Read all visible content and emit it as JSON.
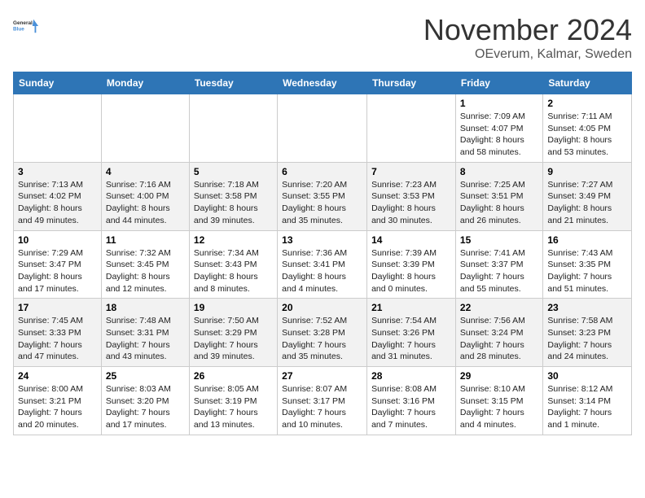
{
  "logo": {
    "line1": "General",
    "line2": "Blue"
  },
  "header": {
    "month": "November 2024",
    "location": "OEverum, Kalmar, Sweden"
  },
  "weekdays": [
    "Sunday",
    "Monday",
    "Tuesday",
    "Wednesday",
    "Thursday",
    "Friday",
    "Saturday"
  ],
  "weeks": [
    [
      {
        "day": "",
        "info": ""
      },
      {
        "day": "",
        "info": ""
      },
      {
        "day": "",
        "info": ""
      },
      {
        "day": "",
        "info": ""
      },
      {
        "day": "",
        "info": ""
      },
      {
        "day": "1",
        "info": "Sunrise: 7:09 AM\nSunset: 4:07 PM\nDaylight: 8 hours and 58 minutes."
      },
      {
        "day": "2",
        "info": "Sunrise: 7:11 AM\nSunset: 4:05 PM\nDaylight: 8 hours and 53 minutes."
      }
    ],
    [
      {
        "day": "3",
        "info": "Sunrise: 7:13 AM\nSunset: 4:02 PM\nDaylight: 8 hours and 49 minutes."
      },
      {
        "day": "4",
        "info": "Sunrise: 7:16 AM\nSunset: 4:00 PM\nDaylight: 8 hours and 44 minutes."
      },
      {
        "day": "5",
        "info": "Sunrise: 7:18 AM\nSunset: 3:58 PM\nDaylight: 8 hours and 39 minutes."
      },
      {
        "day": "6",
        "info": "Sunrise: 7:20 AM\nSunset: 3:55 PM\nDaylight: 8 hours and 35 minutes."
      },
      {
        "day": "7",
        "info": "Sunrise: 7:23 AM\nSunset: 3:53 PM\nDaylight: 8 hours and 30 minutes."
      },
      {
        "day": "8",
        "info": "Sunrise: 7:25 AM\nSunset: 3:51 PM\nDaylight: 8 hours and 26 minutes."
      },
      {
        "day": "9",
        "info": "Sunrise: 7:27 AM\nSunset: 3:49 PM\nDaylight: 8 hours and 21 minutes."
      }
    ],
    [
      {
        "day": "10",
        "info": "Sunrise: 7:29 AM\nSunset: 3:47 PM\nDaylight: 8 hours and 17 minutes."
      },
      {
        "day": "11",
        "info": "Sunrise: 7:32 AM\nSunset: 3:45 PM\nDaylight: 8 hours and 12 minutes."
      },
      {
        "day": "12",
        "info": "Sunrise: 7:34 AM\nSunset: 3:43 PM\nDaylight: 8 hours and 8 minutes."
      },
      {
        "day": "13",
        "info": "Sunrise: 7:36 AM\nSunset: 3:41 PM\nDaylight: 8 hours and 4 minutes."
      },
      {
        "day": "14",
        "info": "Sunrise: 7:39 AM\nSunset: 3:39 PM\nDaylight: 8 hours and 0 minutes."
      },
      {
        "day": "15",
        "info": "Sunrise: 7:41 AM\nSunset: 3:37 PM\nDaylight: 7 hours and 55 minutes."
      },
      {
        "day": "16",
        "info": "Sunrise: 7:43 AM\nSunset: 3:35 PM\nDaylight: 7 hours and 51 minutes."
      }
    ],
    [
      {
        "day": "17",
        "info": "Sunrise: 7:45 AM\nSunset: 3:33 PM\nDaylight: 7 hours and 47 minutes."
      },
      {
        "day": "18",
        "info": "Sunrise: 7:48 AM\nSunset: 3:31 PM\nDaylight: 7 hours and 43 minutes."
      },
      {
        "day": "19",
        "info": "Sunrise: 7:50 AM\nSunset: 3:29 PM\nDaylight: 7 hours and 39 minutes."
      },
      {
        "day": "20",
        "info": "Sunrise: 7:52 AM\nSunset: 3:28 PM\nDaylight: 7 hours and 35 minutes."
      },
      {
        "day": "21",
        "info": "Sunrise: 7:54 AM\nSunset: 3:26 PM\nDaylight: 7 hours and 31 minutes."
      },
      {
        "day": "22",
        "info": "Sunrise: 7:56 AM\nSunset: 3:24 PM\nDaylight: 7 hours and 28 minutes."
      },
      {
        "day": "23",
        "info": "Sunrise: 7:58 AM\nSunset: 3:23 PM\nDaylight: 7 hours and 24 minutes."
      }
    ],
    [
      {
        "day": "24",
        "info": "Sunrise: 8:00 AM\nSunset: 3:21 PM\nDaylight: 7 hours and 20 minutes."
      },
      {
        "day": "25",
        "info": "Sunrise: 8:03 AM\nSunset: 3:20 PM\nDaylight: 7 hours and 17 minutes."
      },
      {
        "day": "26",
        "info": "Sunrise: 8:05 AM\nSunset: 3:19 PM\nDaylight: 7 hours and 13 minutes."
      },
      {
        "day": "27",
        "info": "Sunrise: 8:07 AM\nSunset: 3:17 PM\nDaylight: 7 hours and 10 minutes."
      },
      {
        "day": "28",
        "info": "Sunrise: 8:08 AM\nSunset: 3:16 PM\nDaylight: 7 hours and 7 minutes."
      },
      {
        "day": "29",
        "info": "Sunrise: 8:10 AM\nSunset: 3:15 PM\nDaylight: 7 hours and 4 minutes."
      },
      {
        "day": "30",
        "info": "Sunrise: 8:12 AM\nSunset: 3:14 PM\nDaylight: 7 hours and 1 minute."
      }
    ]
  ]
}
